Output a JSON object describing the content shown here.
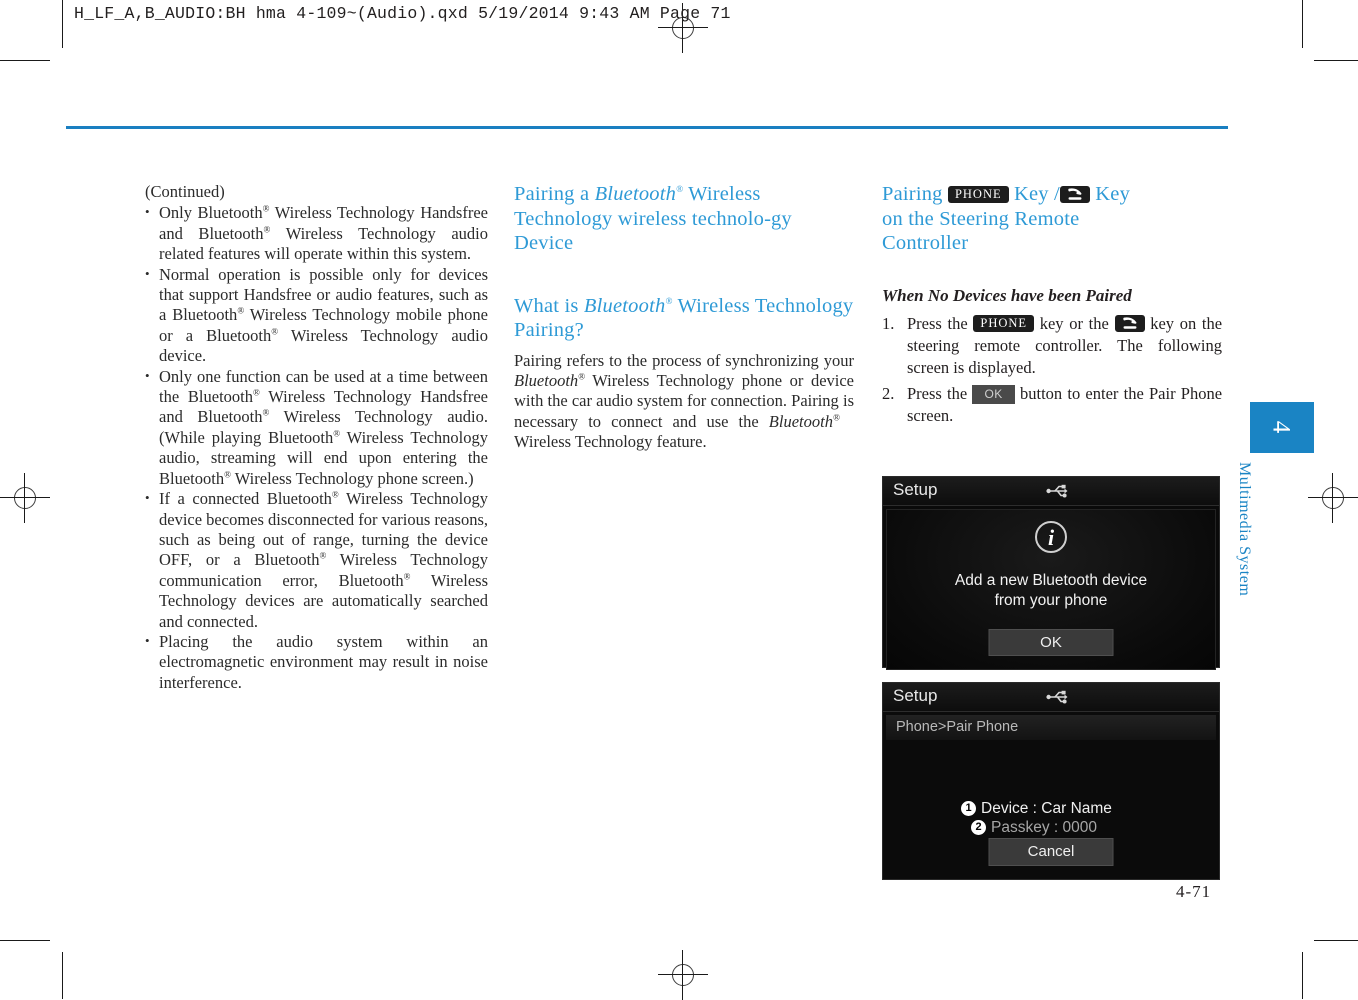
{
  "print": {
    "file_stamp": "H_LF_A,B_AUDIO:BH hma 4-109~(Audio).qxd  5/19/2014  9:43 AM  Page 71"
  },
  "page": {
    "number": "4-71",
    "side_tab": {
      "chapter_number": "4",
      "chapter_label": "Multimedia System"
    }
  },
  "column1": {
    "continued_label": "(Continued)",
    "bullets": [
      "Only Bluetooth® Wireless Technology Handsfree and Bluetooth® Wireless Technology audio related features will operate within this system.",
      "Normal operation is possible only for devices that support Handsfree or audio features, such as a Bluetooth® Wireless Technology mobile phone or a Bluetooth® Wireless Technology audio device.",
      "Only one function can be used at a time between the Bluetooth® Wireless Technology Handsfree and Bluetooth® Wireless Technology audio. (While playing Bluetooth® Wireless Technology audio, streaming will end upon entering the Bluetooth® Wireless Technology phone screen.)",
      "If a connected Bluetooth® Wireless Technology device becomes disconnected for various reasons, such as being out of range, turning the device OFF, or a Bluetooth® Wireless Technology communication error, Bluetooth® Wireless Technology devices are automatically searched and connected.",
      "Placing the audio system within an electromagnetic environment may result in noise interference."
    ]
  },
  "column2": {
    "heading1": "Pairing a Bluetooth® Wireless Technology wireless technology Device",
    "heading2": "What is Bluetooth® Wireless Technology Pairing?",
    "paragraph": "Pairing refers to the process of synchronizing your Bluetooth® Wireless Technology phone or device with the car audio system for connection. Pairing is necessary to connect and use the Bluetooth® Wireless Technology feature."
  },
  "column3": {
    "heading_part1": "Pairing",
    "heading_chip_phone": "PHONE",
    "heading_part2": "Key /",
    "heading_part3": "Key",
    "heading_line2": "on the Steering Remote",
    "heading_line3": "Controller",
    "subhead": "When No Devices have been Paired",
    "steps": [
      {
        "num": "1.",
        "text_a": "Press the",
        "chip_phone": "PHONE",
        "text_b": "key or the",
        "text_c": "key on the steering remote controller. The following screen is displayed."
      },
      {
        "num": "2.",
        "text_a": "Press the",
        "chip_ok": "OK",
        "text_b": "button to enter the Pair Phone screen."
      }
    ]
  },
  "device_screen_1": {
    "title": "Setup",
    "icon": "usb-icon",
    "info_glyph": "i",
    "message_line1": "Add a new Bluetooth device",
    "message_line2": "from your phone",
    "button_label": "OK"
  },
  "device_screen_2": {
    "title": "Setup",
    "icon": "usb-icon",
    "breadcrumb": "Phone>Pair Phone",
    "callout1": "1",
    "callout2": "2",
    "device_line": "Device : Car Name",
    "passkey_line": "Passkey : 0000",
    "button_label": "Cancel"
  },
  "colors": {
    "accent_blue": "#1a7fc1",
    "heading_blue": "#2e9ad6",
    "tab_blue": "#1a84c4",
    "body_text": "#2b2b2b"
  }
}
